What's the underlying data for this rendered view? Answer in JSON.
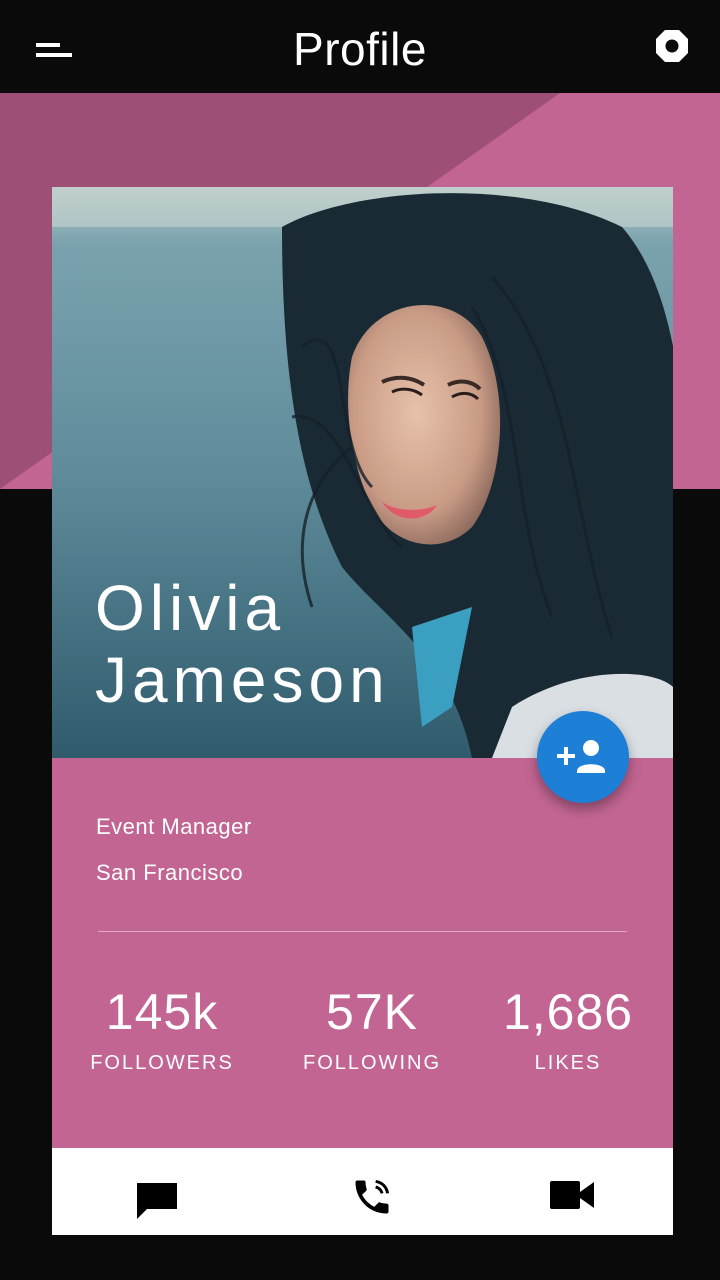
{
  "header": {
    "title": "Profile",
    "menu_icon": "menu-icon",
    "settings_icon": "settings-icon"
  },
  "profile": {
    "first_name": "Olivia",
    "last_name": "Jameson",
    "job": "Event Manager",
    "location": "San Francisco"
  },
  "stats": [
    {
      "value": "145k",
      "label": "FOLLOWERS"
    },
    {
      "value": "57K",
      "label": "FOLLOWING"
    },
    {
      "value": "1,686",
      "label": "LIKES"
    }
  ],
  "fab": {
    "icon": "add-person-icon"
  },
  "actions": [
    {
      "icon": "chat-icon"
    },
    {
      "icon": "phone-icon"
    },
    {
      "icon": "video-camera-icon"
    }
  ],
  "colors": {
    "accent": "#c26592",
    "accent_dark": "#9d4f76",
    "fab": "#1e7fd6",
    "background": "#0a0a0a"
  }
}
